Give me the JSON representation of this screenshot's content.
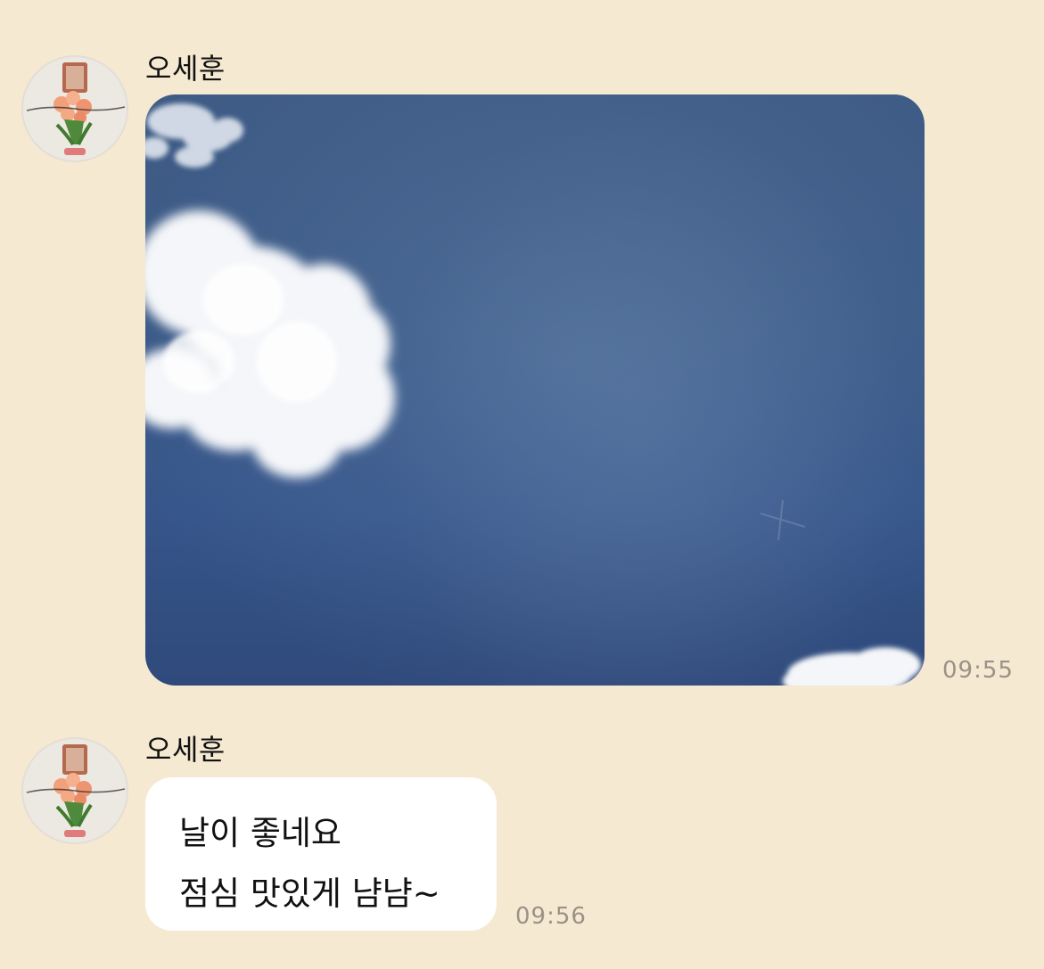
{
  "chat": {
    "messages": [
      {
        "sender": "오세훈",
        "type": "image",
        "image_description_icon": "sky-photo",
        "time": "09:55"
      },
      {
        "sender": "오세훈",
        "type": "text",
        "lines": [
          "날이 좋네요",
          "점심 맛있게 냠냠~"
        ],
        "time": "09:56"
      }
    ]
  },
  "colors": {
    "background": "#f6e9d2",
    "bubble": "#ffffff",
    "timestamp": "#9a9288",
    "text": "#111111"
  }
}
